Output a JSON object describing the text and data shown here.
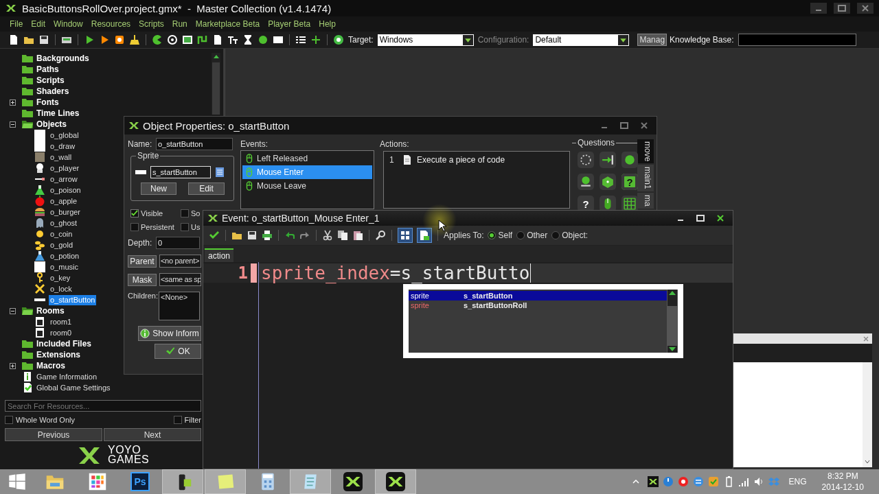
{
  "window": {
    "title": "BasicButtonsRollOver.project.gmx*  -  Master Collection (v1.4.1474)"
  },
  "menu": [
    "File",
    "Edit",
    "Window",
    "Resources",
    "Scripts",
    "Run",
    "Marketplace Beta",
    "Player Beta",
    "Help"
  ],
  "toolbar": {
    "target_label": "Target:",
    "target": "Windows",
    "configuration_label": "Configuration:",
    "configuration_disabled": true,
    "configuration": "Default",
    "manage_button": "Manag",
    "knowledge_base_label": "Knowledge Base:"
  },
  "resource_tree": [
    {
      "label": "Backgrounds",
      "kind": "folder",
      "selected": false
    },
    {
      "label": "Paths",
      "kind": "folder",
      "selected": false
    },
    {
      "label": "Scripts",
      "kind": "folder",
      "selected": false
    },
    {
      "label": "Shaders",
      "kind": "folder",
      "selected": false
    },
    {
      "label": "Fonts",
      "kind": "folder",
      "expanded": false,
      "selected": false
    },
    {
      "label": "Time Lines",
      "kind": "folder",
      "selected": false
    },
    {
      "label": "Objects",
      "kind": "folder",
      "expanded": true,
      "selected": false,
      "children": [
        {
          "label": "o_global",
          "kind": "object",
          "selected": false
        },
        {
          "label": "o_draw",
          "kind": "object",
          "selected": false
        },
        {
          "label": "o_wall",
          "kind": "object",
          "selected": false
        },
        {
          "label": "o_player",
          "kind": "object",
          "selected": false
        },
        {
          "label": "o_arrow",
          "kind": "object",
          "selected": false
        },
        {
          "label": "o_poison",
          "kind": "object",
          "selected": false
        },
        {
          "label": "o_apple",
          "kind": "object",
          "selected": false
        },
        {
          "label": "o_burger",
          "kind": "object",
          "selected": false
        },
        {
          "label": "o_ghost",
          "kind": "object",
          "selected": false
        },
        {
          "label": "o_coin",
          "kind": "object",
          "selected": false
        },
        {
          "label": "o_gold",
          "kind": "object",
          "selected": false
        },
        {
          "label": "o_potion",
          "kind": "object",
          "selected": false
        },
        {
          "label": "o_music",
          "kind": "object",
          "selected": false
        },
        {
          "label": "o_key",
          "kind": "object",
          "selected": false
        },
        {
          "label": "o_lock",
          "kind": "object",
          "selected": false
        },
        {
          "label": "o_startButton",
          "kind": "object",
          "selected": true
        }
      ]
    },
    {
      "label": "Rooms",
      "kind": "folder",
      "expanded": true,
      "selected": false,
      "children": [
        {
          "label": "room1",
          "kind": "room",
          "selected": false
        },
        {
          "label": "room0",
          "kind": "room",
          "selected": false
        }
      ]
    },
    {
      "label": "Included Files",
      "kind": "folder",
      "selected": false
    },
    {
      "label": "Extensions",
      "kind": "folder",
      "selected": false
    },
    {
      "label": "Macros",
      "kind": "folder",
      "expanded": false,
      "selected": false
    },
    {
      "label": "Game Information",
      "kind": "info",
      "selected": false
    },
    {
      "label": "Global Game Settings",
      "kind": "settings",
      "selected": false
    }
  ],
  "resource_search": {
    "placeholder": "Search For Resources...",
    "whole_word": {
      "label": "Whole Word Only",
      "checked": false
    },
    "filter": {
      "label": "Filter",
      "checked": false
    },
    "previous_button": "Previous",
    "next_button": "Next"
  },
  "logo": {
    "top": "YOYO",
    "bottom": "GAMES"
  },
  "object_properties": {
    "title": "Object Properties: o_startButton",
    "name_label": "Name:",
    "name": "o_startButton",
    "sprite_label": "Sprite",
    "sprite": "s_startButton",
    "new_button": "New",
    "edit_button": "Edit",
    "options": [
      {
        "label": "Visible",
        "checked": true
      },
      {
        "label": "So",
        "checked": false
      },
      {
        "label": "Persistent",
        "checked": false
      },
      {
        "label": "Us",
        "checked": false
      }
    ],
    "depth_label": "Depth:",
    "depth": "0",
    "parent_button": "Parent",
    "parent": "<no parent>",
    "mask_button": "Mask",
    "mask": "<same as sp",
    "children_label": "Children:",
    "children": "<None>",
    "info_button": "Show Inform",
    "ok_button": "OK",
    "events_label": "Events:",
    "events": [
      {
        "label": "Left Released",
        "selected": false
      },
      {
        "label": "Mouse Enter",
        "selected": true
      },
      {
        "label": "Mouse Leave",
        "selected": false
      }
    ],
    "actions_label": "Actions:",
    "actions": [
      {
        "number": "1",
        "label": "Execute a piece of code"
      }
    ],
    "questions_label": "Questions",
    "action_buttons": [
      {
        "kind": "dashed-circle"
      },
      {
        "kind": "exit"
      },
      {
        "kind": "ball"
      },
      {
        "kind": "numbered-ball"
      },
      {
        "kind": "dice"
      },
      {
        "kind": "help",
        "label": "?"
      },
      {
        "kind": "question",
        "label": "?"
      },
      {
        "kind": "mouse"
      },
      {
        "kind": "grid"
      }
    ],
    "side_tabs": [
      {
        "label": "move",
        "selected": true
      },
      {
        "label": "main1",
        "selected": false
      },
      {
        "label": "ma",
        "selected": false
      }
    ]
  },
  "event_editor": {
    "title": "Event: o_startButton_Mouse Enter_1",
    "view_toggles": [
      {
        "kind": "grid",
        "on": true
      },
      {
        "kind": "page",
        "on": true
      }
    ],
    "applies_label": "Applies To:",
    "applies_to": [
      {
        "label": "Self",
        "selected": true
      },
      {
        "label": "Other",
        "selected": false
      },
      {
        "label": "Object:",
        "selected": false
      }
    ],
    "tabs": [
      {
        "label": "action",
        "selected": true
      }
    ],
    "lines": [
      {
        "number": "1",
        "tokens": [
          {
            "text": "sprite_index",
            "kind": "variable"
          },
          {
            "text": "=s_startButto",
            "kind": "plain"
          }
        ]
      }
    ],
    "autocomplete": [
      {
        "type": "sprite",
        "name": "s_startButton",
        "selected": true
      },
      {
        "type": "sprite",
        "name": "s_startButtonRoll",
        "selected": false
      }
    ]
  },
  "taskbar": {
    "apps": [
      {
        "kind": "folder",
        "running": false
      },
      {
        "kind": "store",
        "running": false
      },
      {
        "kind": "photoshop",
        "label": "Ps",
        "running": false
      },
      {
        "kind": "device",
        "running": true
      },
      {
        "kind": "notes",
        "running": true
      },
      {
        "kind": "calculator",
        "running": false
      },
      {
        "kind": "notepad",
        "running": true
      },
      {
        "kind": "gamemaker",
        "running": false
      },
      {
        "kind": "gamemaker",
        "running": true
      }
    ],
    "language": "ENG",
    "time": "8:32 PM",
    "date": "2014-12-10"
  }
}
